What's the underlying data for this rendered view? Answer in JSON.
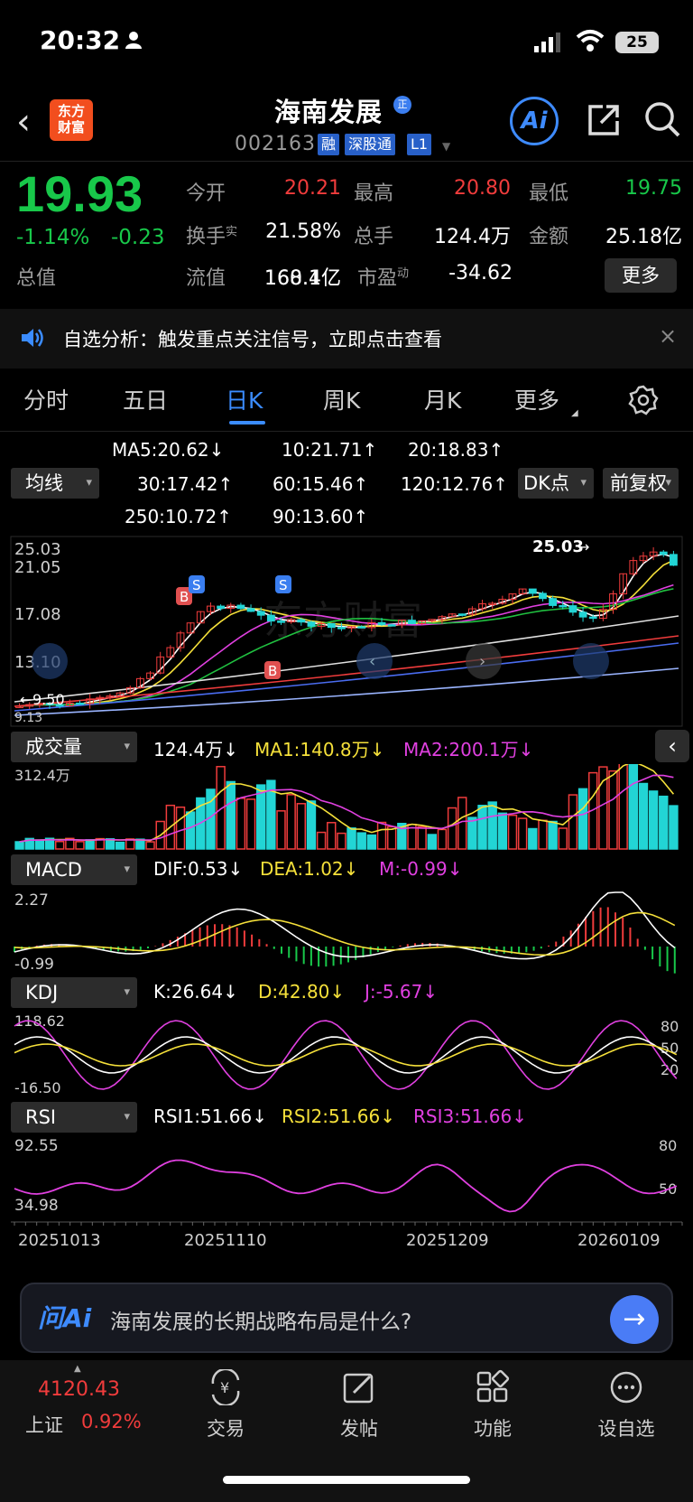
{
  "status_bar": {
    "time": "20:32",
    "battery": "25"
  },
  "header": {
    "back_icon": "chevron-left-icon",
    "logo": "东方\n财富",
    "stock_name": "海南发展",
    "reg_badge": "正",
    "stock_code": "002163",
    "tags": [
      "融",
      "深股通",
      "L1"
    ],
    "ai_label": "Ai"
  },
  "quote": {
    "price": "19.93",
    "change_pct": "-1.14%",
    "change_abs": "-0.23",
    "fields": [
      {
        "label": "今开",
        "value": "20.21",
        "color": "red"
      },
      {
        "label": "最高",
        "value": "20.80",
        "color": "red"
      },
      {
        "label": "最低",
        "value": "19.75",
        "color": "green"
      },
      {
        "label": "换手",
        "sup": "实",
        "value": "21.58%",
        "color": "white"
      },
      {
        "label": "总手",
        "value": "124.4万",
        "color": "white"
      },
      {
        "label": "金额",
        "value": "25.18亿",
        "color": "white"
      },
      {
        "label": "总值",
        "value": "168.4亿",
        "color": "white"
      },
      {
        "label": "流值",
        "value": "160.1亿",
        "color": "white"
      },
      {
        "label": "市盈",
        "sup": "动",
        "value": "-34.62",
        "color": "white"
      }
    ],
    "more_label": "更多"
  },
  "banner": {
    "text": "自选分析：触发重点关注信号，立即点击查看",
    "close": "×"
  },
  "tabs": [
    "分时",
    "五日",
    "日K",
    "周K",
    "月K",
    "更多"
  ],
  "active_tab": 2,
  "ma": {
    "selector": "均线",
    "dk_label": "DK点",
    "fq_label": "前复权",
    "items": [
      {
        "text": "MA5:20.62↓",
        "color": "#ffffff"
      },
      {
        "text": "10:21.71↑",
        "color": "#f5e03a"
      },
      {
        "text": "20:18.83↑",
        "color": "#e040e0"
      },
      {
        "text": "30:17.42↑",
        "color": "#20c040"
      },
      {
        "text": "60:15.46↑",
        "color": "#e0e0e0"
      },
      {
        "text": "120:12.76↑",
        "color": "#4a6cf0"
      },
      {
        "text": "250:10.72↑",
        "color": "#9ab4ff"
      },
      {
        "text": "90:13.60↑",
        "color": "#f03c3c"
      }
    ]
  },
  "kline": {
    "y_labels": [
      "25.03",
      "21.05",
      "17.08",
      "13.10",
      "9.13"
    ],
    "high_marker": "25.03",
    "low_marker": "9.50",
    "watermark": "东方财富"
  },
  "volume": {
    "selector": "成交量",
    "items": [
      {
        "text": "124.4万↓",
        "color": "#ffffff"
      },
      {
        "text": "MA1:140.8万↓",
        "color": "#f5e03a"
      },
      {
        "text": "MA2:200.1万↓",
        "color": "#e040e0"
      }
    ],
    "top_label": "312.4万"
  },
  "macd": {
    "selector": "MACD",
    "items": [
      {
        "text": "DIF:0.53↓",
        "color": "#ffffff"
      },
      {
        "text": "DEA:1.02↓",
        "color": "#f5e03a"
      },
      {
        "text": "M:-0.99↓",
        "color": "#e040e0"
      }
    ],
    "top": "2.27",
    "bottom": "-0.99"
  },
  "kdj": {
    "selector": "KDJ",
    "items": [
      {
        "text": "K:26.64↓",
        "color": "#ffffff"
      },
      {
        "text": "D:42.80↓",
        "color": "#f5e03a"
      },
      {
        "text": "J:-5.67↓",
        "color": "#e040e0"
      }
    ],
    "top": "118.62",
    "bottom": "-16.50",
    "right": [
      "80",
      "50",
      "20"
    ]
  },
  "rsi": {
    "selector": "RSI",
    "items": [
      {
        "text": "RSI1:51.66↓",
        "color": "#ffffff"
      },
      {
        "text": "RSI2:51.66↓",
        "color": "#f5e03a"
      },
      {
        "text": "RSI3:51.66↓",
        "color": "#e040e0"
      }
    ],
    "top": "92.55",
    "bottom": "34.98",
    "right": [
      "80",
      "50"
    ]
  },
  "dates": [
    "20251013",
    "20251110",
    "20251209",
    "20260109"
  ],
  "ai_bar": {
    "logo": "问Ai",
    "prompt": "海南发展的长期战略布局是什么?"
  },
  "nav": {
    "index_value": "4120.43",
    "index_name": "上证",
    "index_change": "0.92%",
    "items": [
      {
        "label": "交易",
        "icon": "yen-exchange-icon"
      },
      {
        "label": "发帖",
        "icon": "edit-icon"
      },
      {
        "label": "功能",
        "icon": "grid-icon"
      },
      {
        "label": "设自选",
        "icon": "more-icon"
      }
    ]
  }
}
